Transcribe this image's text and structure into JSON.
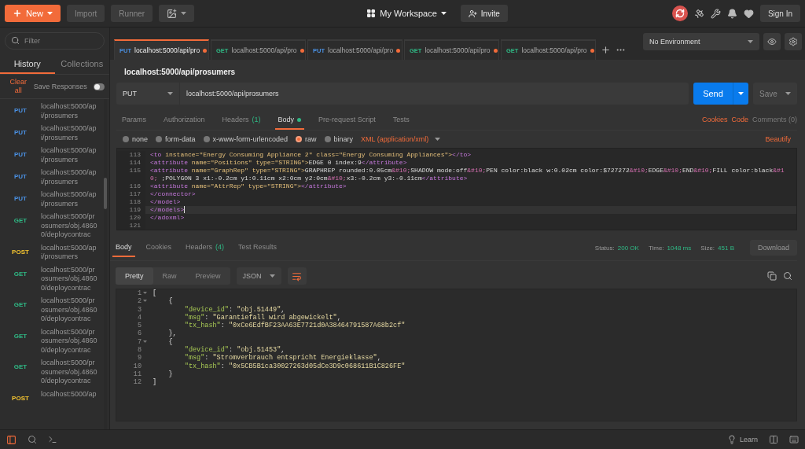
{
  "header": {
    "new_button": "New",
    "import_button": "Import",
    "runner_button": "Runner",
    "workspace": "My Workspace",
    "invite_button": "Invite",
    "sign_in_button": "Sign In"
  },
  "sidebar": {
    "filter_placeholder": "Filter",
    "tabs": [
      {
        "label": "History",
        "selected": true
      },
      {
        "label": "Collections",
        "selected": false
      }
    ],
    "clear_all": "Clear all",
    "save_responses": {
      "label": "Save Responses",
      "on": false
    },
    "history": [
      {
        "method": "PUT",
        "color": "#4a90e2",
        "url": "localhost:5000/api/prosumers"
      },
      {
        "method": "PUT",
        "color": "#4a90e2",
        "url": "localhost:5000/api/prosumers"
      },
      {
        "method": "PUT",
        "color": "#4a90e2",
        "url": "localhost:5000/api/prosumers"
      },
      {
        "method": "PUT",
        "color": "#4a90e2",
        "url": "localhost:5000/api/prosumers"
      },
      {
        "method": "PUT",
        "color": "#4a90e2",
        "url": "localhost:5000/api/prosumers"
      },
      {
        "method": "GET",
        "color": "#2fb985",
        "url": "localhost:5000/prosumers/obj.48600/deploycontrac"
      },
      {
        "method": "POST",
        "color": "#f4c430",
        "url": "localhost:5000/api/prosumers"
      },
      {
        "method": "GET",
        "color": "#2fb985",
        "url": "localhost:5000/prosumers/obj.48600/deploycontrac"
      },
      {
        "method": "GET",
        "color": "#2fb985",
        "url": "localhost:5000/prosumers/obj.48600/deploycontrac"
      },
      {
        "method": "GET",
        "color": "#2fb985",
        "url": "localhost:5000/prosumers/obj.48600/deploycontrac"
      },
      {
        "method": "GET",
        "color": "#2fb985",
        "url": "localhost:5000/prosumers/obj.48600/deploycontrac"
      },
      {
        "method": "POST",
        "color": "#f4c430",
        "url": "localhost:5000/ap"
      }
    ]
  },
  "request_tabs": [
    {
      "method": "PUT",
      "color": "#4a90e2",
      "url": "localhost:5000/api/pro",
      "selected": true,
      "unsaved": true
    },
    {
      "method": "GET",
      "color": "#2fb985",
      "url": "localhost:5000/api/pro",
      "selected": false,
      "unsaved": true
    },
    {
      "method": "PUT",
      "color": "#4a90e2",
      "url": "localhost:5000/api/pro",
      "selected": false,
      "unsaved": true
    },
    {
      "method": "GET",
      "color": "#2fb985",
      "url": "localhost:5000/api/pro",
      "selected": false,
      "unsaved": true
    },
    {
      "method": "GET",
      "color": "#2fb985",
      "url": "localhost:5000/api/pro",
      "selected": false,
      "unsaved": true
    }
  ],
  "environment": "No Environment",
  "request": {
    "title": "localhost:5000/api/prosumers",
    "method": "PUT",
    "url": "localhost:5000/api/prosumers",
    "send": "Send",
    "save": "Save",
    "tabs": [
      {
        "label": "Params",
        "selected": false,
        "dot": false
      },
      {
        "label": "Authorization",
        "selected": false,
        "dot": false
      },
      {
        "label": "Headers",
        "count": "(1)",
        "selected": false,
        "dot": false
      },
      {
        "label": "Body",
        "selected": true,
        "dot": true
      },
      {
        "label": "Pre-request Script",
        "selected": false,
        "dot": false
      },
      {
        "label": "Tests",
        "selected": false,
        "dot": false
      }
    ],
    "links": [
      {
        "label": "Cookies",
        "disabled": false
      },
      {
        "label": "Code",
        "disabled": false
      },
      {
        "label": "Comments (0)",
        "disabled": true
      }
    ],
    "body_modes": [
      {
        "label": "none",
        "selected": false
      },
      {
        "label": "form-data",
        "selected": false
      },
      {
        "label": "x-www-form-urlencoded",
        "selected": false
      },
      {
        "label": "raw",
        "selected": true
      },
      {
        "label": "binary",
        "selected": false
      }
    ],
    "body_type": "XML (application/xml)",
    "beautify": "Beautify",
    "lines": [
      {
        "number": "113",
        "active": false,
        "segments": [
          {
            "kind": "tag",
            "text": "<to"
          },
          {
            "kind": "attr",
            "text": " instance=\"Energy Consuming Appliance 2\" class=\"Energy Consuming Appliances\">"
          },
          {
            "kind": "tag",
            "text": "</to>"
          }
        ]
      },
      {
        "number": "114",
        "active": false,
        "segments": [
          {
            "kind": "tag",
            "text": "<attribute"
          },
          {
            "kind": "attr",
            "text": " name=\"Positions\" type=\"STRING\">"
          },
          {
            "kind": "text",
            "text": "EDGE 0 index:9"
          },
          {
            "kind": "tag",
            "text": "</attribute>"
          }
        ]
      },
      {
        "number": "115",
        "active": false,
        "segments": [
          {
            "kind": "tag",
            "text": "<attribute"
          },
          {
            "kind": "attr",
            "text": " name=\"GraphRep\" type=\"STRING\">"
          },
          {
            "kind": "text",
            "text": "GRAPHREP rounded:0.05cm"
          },
          {
            "kind": "ent",
            "text": "&#10;"
          },
          {
            "kind": "text",
            "text": "SHADOW mode:off"
          },
          {
            "kind": "ent",
            "text": "&#10;"
          },
          {
            "kind": "text",
            "text": "PEN color:black w:0.02cm color:$727272"
          },
          {
            "kind": "ent",
            "text": "&#10;"
          },
          {
            "kind": "text",
            "text": "EDGE"
          },
          {
            "kind": "ent",
            "text": "&#10;"
          },
          {
            "kind": "text",
            "text": "END"
          },
          {
            "kind": "ent",
            "text": "&#10;"
          },
          {
            "kind": "text",
            "text": "FILL color:black"
          },
          {
            "kind": "ent",
            "text": "&#10;"
          },
          {
            "kind": "text",
            "text": " ;POLYGON 3 x1:-0.2cm y1:0.11cm x2:0cm y2:0cm"
          },
          {
            "kind": "ent",
            "text": "&#10;"
          },
          {
            "kind": "text",
            "text": "x3:-0.2cm y3:-0.11cm"
          },
          {
            "kind": "tag",
            "text": "</attribute>"
          }
        ]
      },
      {
        "number": "116",
        "active": false,
        "segments": [
          {
            "kind": "tag",
            "text": "<attribute"
          },
          {
            "kind": "attr",
            "text": " name=\"AttrRep\" type=\"STRING\">"
          },
          {
            "kind": "tag",
            "text": "</attribute>"
          }
        ]
      },
      {
        "number": "117",
        "active": false,
        "segments": [
          {
            "kind": "tag",
            "text": "</connector>"
          }
        ]
      },
      {
        "number": "118",
        "active": false,
        "segments": [
          {
            "kind": "tag",
            "text": "</model>"
          }
        ]
      },
      {
        "number": "119",
        "active": true,
        "segments": [
          {
            "kind": "tag",
            "text": "</models>"
          }
        ]
      },
      {
        "number": "120",
        "active": false,
        "segments": [
          {
            "kind": "tag",
            "text": "</adoxml>"
          }
        ]
      },
      {
        "number": "121",
        "active": false
      }
    ]
  },
  "response": {
    "tabs": [
      {
        "label": "Body",
        "selected": true
      },
      {
        "label": "Cookies",
        "selected": false
      },
      {
        "label": "Headers",
        "count": "(4)",
        "selected": false
      },
      {
        "label": "Test Results",
        "selected": false
      }
    ],
    "stats": [
      {
        "label": "Status:",
        "value": "200 OK"
      },
      {
        "label": "Time:",
        "value": "1048 ms"
      },
      {
        "label": "Size:",
        "value": "451 B"
      }
    ],
    "download": "Download",
    "views": [
      {
        "label": "Pretty",
        "selected": true
      },
      {
        "label": "Raw",
        "selected": false
      },
      {
        "label": "Preview",
        "selected": false
      }
    ],
    "format": "JSON",
    "lines": [
      {
        "number": "1",
        "fold": true,
        "segments": [
          {
            "kind": "punct",
            "text": "["
          }
        ]
      },
      {
        "number": "2",
        "fold": true,
        "segments": [
          {
            "kind": "punct",
            "text": "    {"
          }
        ]
      },
      {
        "number": "3",
        "fold": false,
        "segments": [
          {
            "kind": "key",
            "text": "        \"device_id\""
          },
          {
            "kind": "punct",
            "text": ": "
          },
          {
            "kind": "str",
            "text": "\"obj.51449\""
          },
          {
            "kind": "punct",
            "text": ","
          }
        ]
      },
      {
        "number": "4",
        "fold": false,
        "segments": [
          {
            "kind": "key",
            "text": "        \"msg\""
          },
          {
            "kind": "punct",
            "text": ": "
          },
          {
            "kind": "str",
            "text": "\"Garantiefall wird abgewickelt\""
          },
          {
            "kind": "punct",
            "text": ","
          }
        ]
      },
      {
        "number": "5",
        "fold": false,
        "segments": [
          {
            "kind": "key",
            "text": "        \"tx_hash\""
          },
          {
            "kind": "punct",
            "text": ": "
          },
          {
            "kind": "str",
            "text": "\"0xCe6EdfBF23AA63E7721d0A38464791587A68b2cf\""
          }
        ]
      },
      {
        "number": "6",
        "fold": false,
        "segments": [
          {
            "kind": "punct",
            "text": "    },"
          }
        ]
      },
      {
        "number": "7",
        "fold": true,
        "segments": [
          {
            "kind": "punct",
            "text": "    {"
          }
        ]
      },
      {
        "number": "8",
        "fold": false,
        "segments": [
          {
            "kind": "key",
            "text": "        \"device_id\""
          },
          {
            "kind": "punct",
            "text": ": "
          },
          {
            "kind": "str",
            "text": "\"obj.51453\""
          },
          {
            "kind": "punct",
            "text": ","
          }
        ]
      },
      {
        "number": "9",
        "fold": false,
        "segments": [
          {
            "kind": "key",
            "text": "        \"msg\""
          },
          {
            "kind": "punct",
            "text": ": "
          },
          {
            "kind": "str",
            "text": "\"Stromverbrauch entspricht Energieklasse\""
          },
          {
            "kind": "punct",
            "text": ","
          }
        ]
      },
      {
        "number": "10",
        "fold": false,
        "segments": [
          {
            "kind": "key",
            "text": "        \"tx_hash\""
          },
          {
            "kind": "punct",
            "text": ": "
          },
          {
            "kind": "str",
            "text": "\"0x5CB5B1ca30027263d05dCe3D9c068611B1C826FE\""
          }
        ]
      },
      {
        "number": "11",
        "fold": false,
        "segments": [
          {
            "kind": "punct",
            "text": "    }"
          }
        ]
      },
      {
        "number": "12",
        "fold": false,
        "segments": [
          {
            "kind": "punct",
            "text": "]"
          }
        ]
      }
    ]
  },
  "status_bar": {
    "learn": "Learn"
  }
}
